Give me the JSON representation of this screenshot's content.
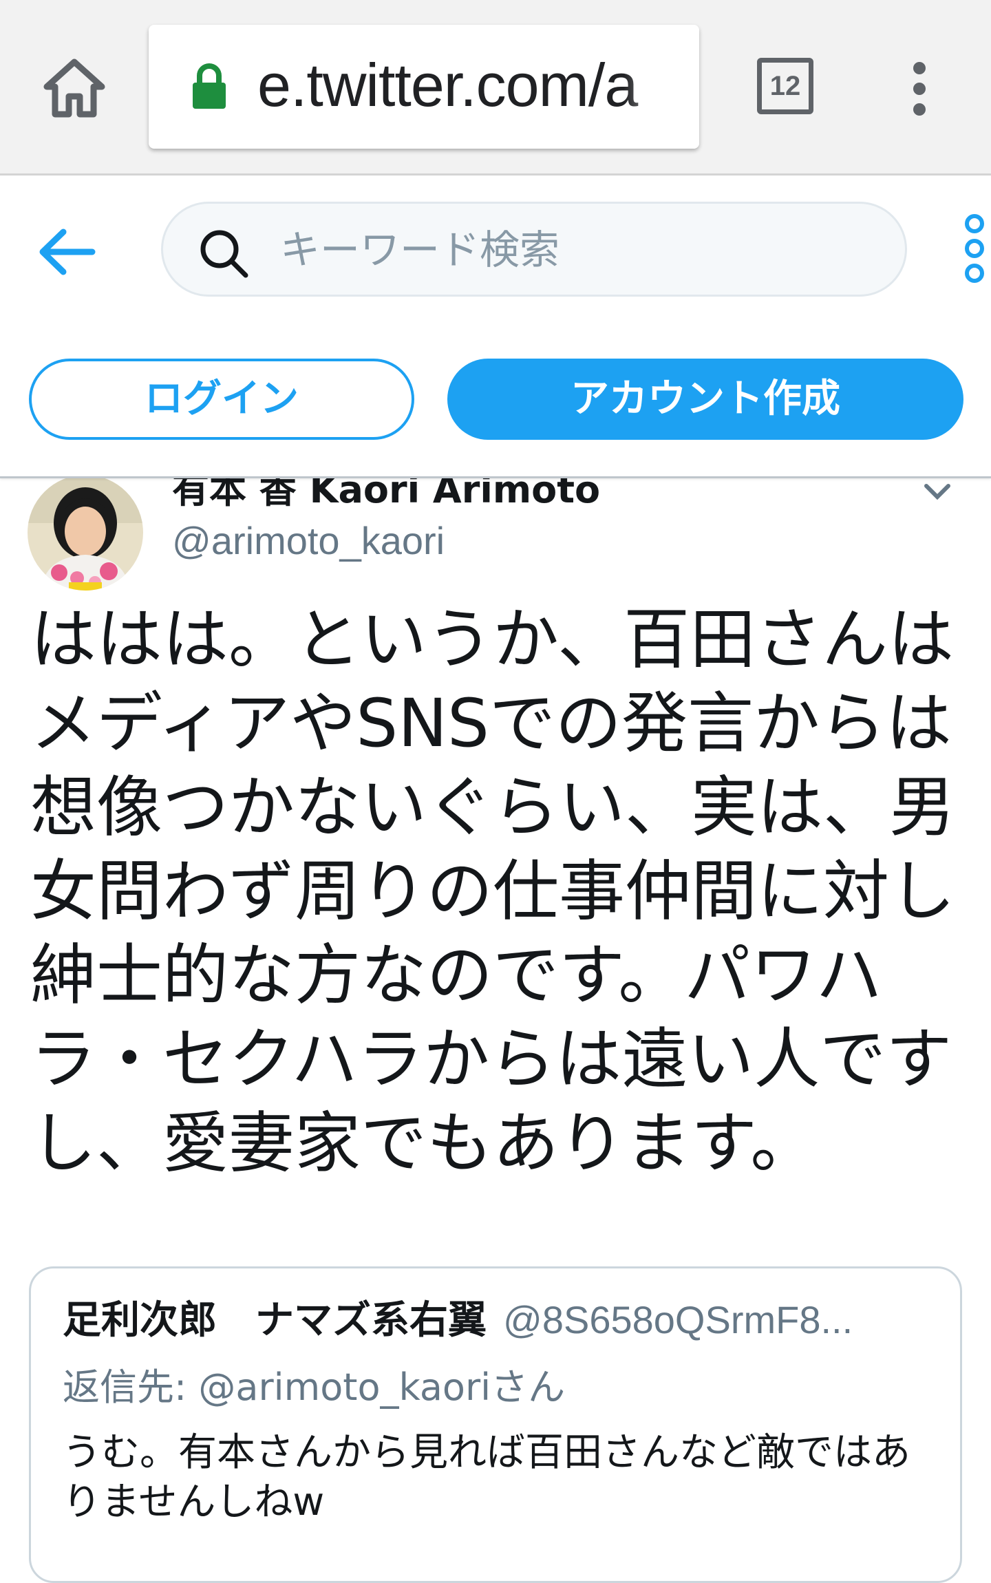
{
  "browser": {
    "url": "e.twitter.com/a",
    "tab_count": "12",
    "icons": {
      "home": "home-icon",
      "lock": "lock-icon",
      "menu": "more-vertical-icon"
    }
  },
  "header": {
    "search": {
      "placeholder": "キーワード検索",
      "value": ""
    },
    "login_label": "ログイン",
    "signup_label": "アカウント作成",
    "icons": {
      "back": "arrow-left-icon",
      "search": "search-icon",
      "more": "more-vertical-icon"
    }
  },
  "tweet": {
    "display_name": "有本 香 Kaori Arimoto",
    "screen_name": "@arimoto_kaori",
    "text": "ははは。というか、百田さんはメディアやSNSでの発言からは想像つかないぐらい、実は、男女問わず周りの仕事仲間に対し紳士的な方なのです。パワハラ・セクハラからは遠い人ですし、愛妻家でもあります。",
    "quoted": {
      "display_name": "足利次郎　ナマズ系右翼",
      "screen_name": "@8S658oQSrmF8...",
      "replying_to": "返信先: @arimoto_kaoriさん",
      "text": "うむ。有本さんから見れば百田さんなど敵ではありませんしねw"
    }
  },
  "colors": {
    "twitter_blue": "#1da1f2",
    "secure_green": "#1e8e3e",
    "text_primary": "#14171a",
    "text_secondary": "#657786"
  }
}
